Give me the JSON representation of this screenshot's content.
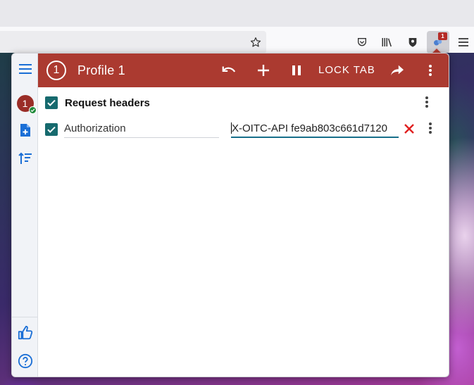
{
  "browser": {
    "extension_badge": "1"
  },
  "popup": {
    "header": {
      "profile_number": "1",
      "profile_title": "Profile 1",
      "lock_tab_label": "LOCK TAB"
    },
    "sidebar": {
      "profile_number": "1"
    },
    "request_headers": {
      "section_label": "Request headers",
      "rows": [
        {
          "name": "Authorization",
          "value": "X-OITC-API fe9ab803c661d7120"
        }
      ]
    }
  },
  "colors": {
    "header_bg": "#ab3a30",
    "checkbox": "#166a6e",
    "accent_blue": "#1b6fd6",
    "delete_red": "#e02020"
  }
}
